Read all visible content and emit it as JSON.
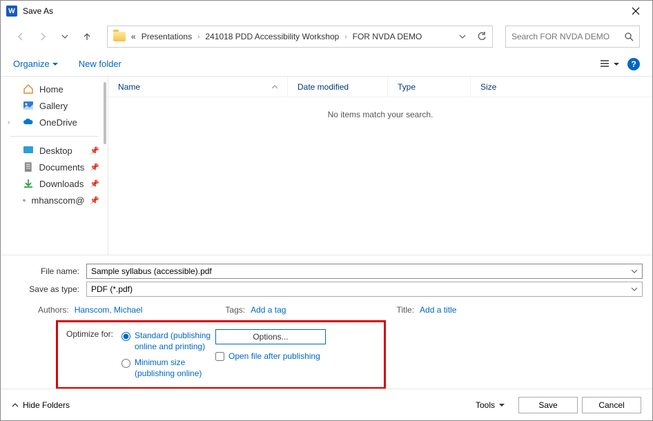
{
  "title": "Save As",
  "breadcrumb": {
    "ellipsis": "«",
    "parts": [
      "Presentations",
      "241018 PDD Accessibility Workshop",
      "FOR NVDA DEMO"
    ]
  },
  "search": {
    "placeholder": "Search FOR NVDA DEMO"
  },
  "cmdbar": {
    "organize": "Organize",
    "newfolder": "New folder"
  },
  "sidebar": {
    "home": "Home",
    "gallery": "Gallery",
    "onedrive": "OneDrive",
    "desktop": "Desktop",
    "documents": "Documents",
    "downloads": "Downloads",
    "mhanscom": "mhanscom@"
  },
  "columns": {
    "name": "Name",
    "date": "Date modified",
    "type": "Type",
    "size": "Size"
  },
  "empty_message": "No items match your search.",
  "form": {
    "filename_label": "File name:",
    "filename_value": "Sample syllabus (accessible).pdf",
    "savetype_label": "Save as type:",
    "savetype_value": "PDF (*.pdf)"
  },
  "meta": {
    "authors_label": "Authors:",
    "authors_value": "Hanscom, Michael",
    "tags_label": "Tags:",
    "tags_value": "Add a tag",
    "title_label": "Title:",
    "title_value": "Add a title"
  },
  "optimize": {
    "label": "Optimize for:",
    "standard": "Standard (publishing online and printing)",
    "minimum": "Minimum size (publishing online)",
    "options_btn": "Options...",
    "open_after": "Open file after publishing"
  },
  "footer": {
    "hide": "Hide Folders",
    "tools": "Tools",
    "save": "Save",
    "cancel": "Cancel"
  }
}
